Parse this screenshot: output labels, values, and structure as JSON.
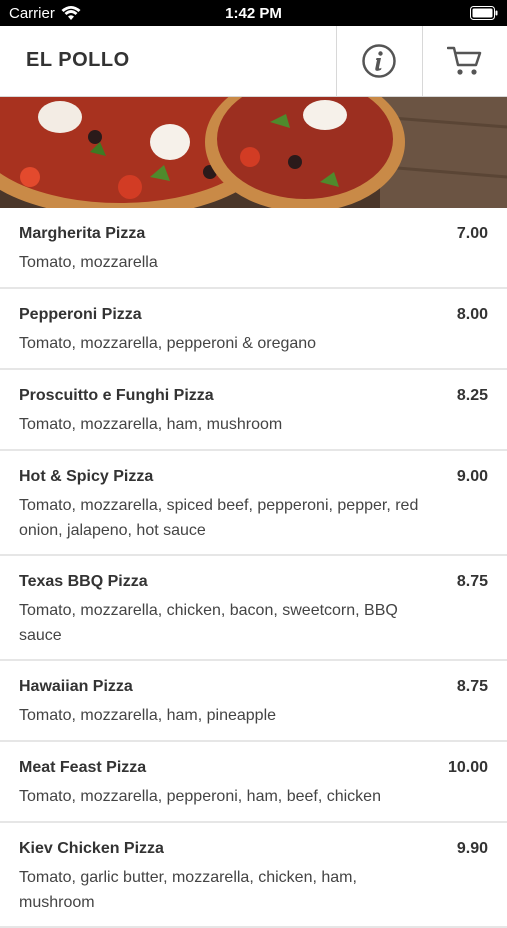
{
  "status_bar": {
    "carrier": "Carrier",
    "time": "1:42 PM"
  },
  "header": {
    "title": "EL POLLO",
    "info_icon": "info-icon",
    "cart_icon": "cart-icon"
  },
  "menu": [
    {
      "name": "Margherita Pizza",
      "price": "7.00",
      "desc": "Tomato, mozzarella"
    },
    {
      "name": "Pepperoni Pizza",
      "price": "8.00",
      "desc": "Tomato, mozzarella, pepperoni & oregano"
    },
    {
      "name": "Proscuitto e Funghi Pizza",
      "price": "8.25",
      "desc": "Tomato, mozzarella, ham, mushroom"
    },
    {
      "name": "Hot & Spicy Pizza",
      "price": "9.00",
      "desc": "Tomato, mozzarella, spiced beef, pepperoni, pepper, red onion, jalapeno, hot sauce"
    },
    {
      "name": "Texas BBQ Pizza",
      "price": "8.75",
      "desc": "Tomato, mozzarella, chicken, bacon, sweetcorn, BBQ sauce"
    },
    {
      "name": "Hawaiian Pizza",
      "price": "8.75",
      "desc": "Tomato, mozzarella, ham, pineapple"
    },
    {
      "name": "Meat Feast Pizza",
      "price": "10.00",
      "desc": "Tomato, mozzarella, pepperoni, ham, beef, chicken"
    },
    {
      "name": "Kiev Chicken Pizza",
      "price": "9.90",
      "desc": "Tomato, garlic butter, mozzarella, chicken, ham, mushroom"
    }
  ]
}
